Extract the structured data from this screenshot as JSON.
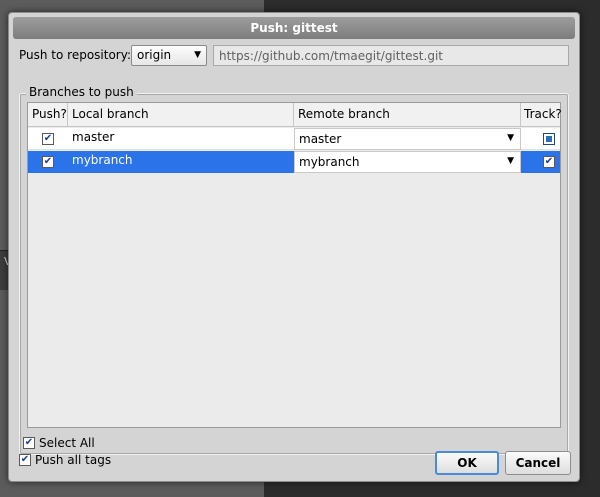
{
  "dialog": {
    "title": "Push: gittest",
    "repo_label": "Push to repository:",
    "repo_selected": "origin",
    "repo_url": "https://github.com/tmaegit/gittest.git",
    "group_title": "Branches to push",
    "columns": {
      "push": "Push?",
      "local": "Local branch",
      "remote": "Remote branch",
      "track": "Track?"
    },
    "rows": [
      {
        "push": true,
        "local": "master",
        "remote": "master",
        "track": "partial",
        "selected": false
      },
      {
        "push": true,
        "local": "mybranch",
        "remote": "mybranch",
        "track": true,
        "selected": true
      }
    ],
    "select_all_label": "Select All",
    "push_tags_label": "Push all tags",
    "ok_label": "OK",
    "cancel_label": "Cancel"
  },
  "background": {
    "partial_text": "V"
  }
}
